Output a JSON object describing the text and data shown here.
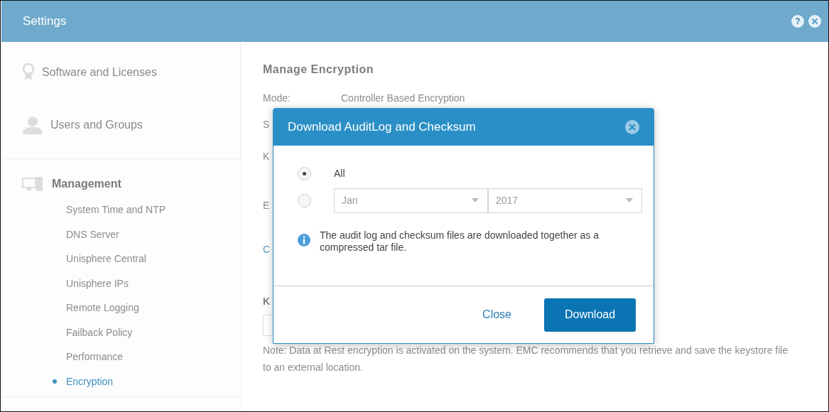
{
  "window": {
    "title": "Settings",
    "help": "?"
  },
  "sidebar": {
    "items": [
      {
        "label": "Software and Licenses",
        "selected": false
      },
      {
        "label": "Users and Groups",
        "selected": false
      }
    ],
    "section": {
      "label": "Management",
      "children": [
        {
          "label": "System Time and NTP",
          "selected": false
        },
        {
          "label": "DNS Server",
          "selected": false
        },
        {
          "label": "Unisphere Central",
          "selected": false
        },
        {
          "label": "Unisphere IPs",
          "selected": false
        },
        {
          "label": "Remote Logging",
          "selected": false
        },
        {
          "label": "Failback Policy",
          "selected": false
        },
        {
          "label": "Performance",
          "selected": false
        },
        {
          "label": "Encryption",
          "selected": true
        }
      ]
    }
  },
  "main": {
    "title": "Manage Encryption",
    "mode_label": "Mode:",
    "mode_value": "Controller Based Encryption",
    "fragments": [
      "S",
      "K",
      "E",
      "C",
      "K"
    ],
    "note": "Note: Data at Rest encryption is activated on the system. EMC recommends that you retrieve and save the keystore file to an external location."
  },
  "dialog": {
    "title": "Download AuditLog and Checksum",
    "options": [
      {
        "kind": "label",
        "label": "All",
        "selected": true
      },
      {
        "kind": "month",
        "month": "Jan",
        "year": "2017",
        "selected": false
      }
    ],
    "info": "The audit log and checksum files are downloaded together as a compressed tar file.",
    "buttons": [
      {
        "kind": "link",
        "label": "Close"
      },
      {
        "kind": "primary",
        "label": "Download"
      }
    ]
  }
}
